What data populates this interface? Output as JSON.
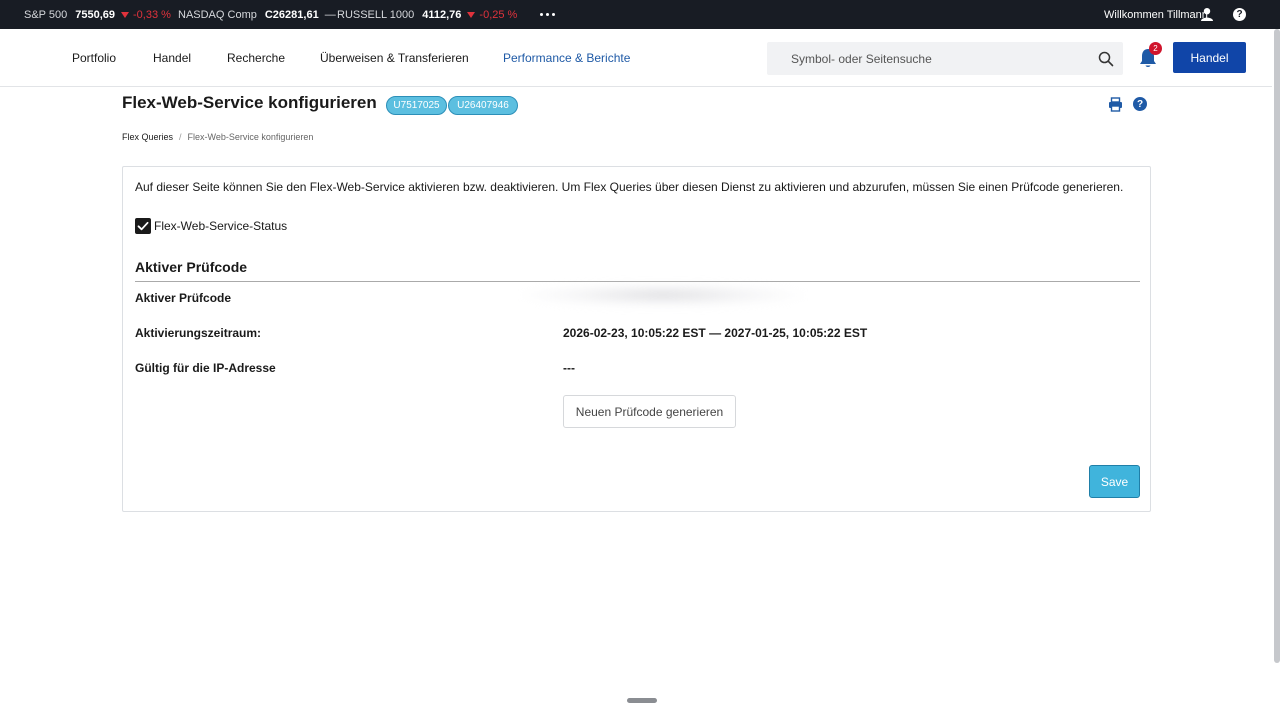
{
  "ticker": {
    "items": [
      {
        "name": "S&P 500",
        "value": "7550,69",
        "change": "-0,33 %",
        "direction": "down"
      },
      {
        "name": "NASDAQ Comp",
        "value": "C26281,61",
        "change": "—",
        "direction": "flat"
      },
      {
        "name": "RUSSELL 1000",
        "value": "4112,76",
        "change": "-0,25 %",
        "direction": "down"
      }
    ],
    "welcome": "Willkommen Tillmann",
    "help_glyph": "?",
    "down_color": "#e0323c"
  },
  "nav": {
    "links": [
      "Portfolio",
      "Handel",
      "Recherche",
      "Überweisen & Transferieren",
      "Performance & Berichte"
    ],
    "active_link": "Performance & Berichte",
    "search_placeholder": "Symbol- oder Seitensuche",
    "notification_count": "2",
    "trade_button": "Handel",
    "accent_color": "#1045a8"
  },
  "page": {
    "title": "Flex-Web-Service konfigurieren",
    "accounts": [
      "U7517025",
      "U26407946"
    ],
    "help_glyph": "?",
    "breadcrumb": {
      "parent": "Flex Queries",
      "separator": "/",
      "current": "Flex-Web-Service konfigurieren"
    }
  },
  "panel": {
    "intro": "Auf dieser Seite können Sie den Flex-Web-Service aktivieren bzw. deaktivieren. Um Flex Queries über diesen Dienst zu aktivieren und abzurufen, müssen Sie einen Prüfcode generieren.",
    "status_label": "Flex-Web-Service-Status",
    "status_checked": true,
    "section_title": "Aktiver Prüfcode",
    "rows": [
      {
        "label": "Aktiver Prüfcode",
        "value": ""
      },
      {
        "label": "Aktivierungszeitraum:",
        "value": "2026-02-23, 10:05:22 EST — 2027-01-25, 10:05:22 EST"
      },
      {
        "label": "Gültig für die IP-Adresse",
        "value": "---"
      }
    ],
    "generate_button": "Neuen Prüfcode generieren",
    "save_button": "Save"
  }
}
